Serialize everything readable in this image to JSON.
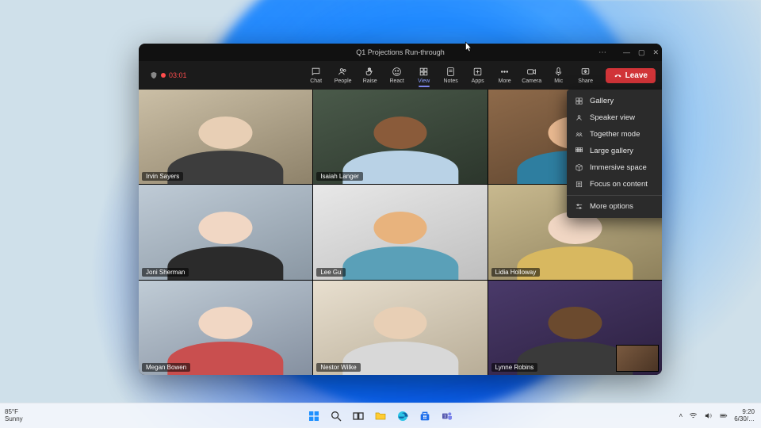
{
  "window": {
    "title": "Q1 Projections Run-through",
    "recording_timer": "03:01"
  },
  "toolbar": {
    "chat": "Chat",
    "people": "People",
    "raise": "Raise",
    "react": "React",
    "view": "View",
    "notes": "Notes",
    "apps": "Apps",
    "more": "More",
    "camera": "Camera",
    "mic": "Mic",
    "share": "Share",
    "leave": "Leave"
  },
  "view_menu": {
    "gallery": "Gallery",
    "speaker": "Speaker view",
    "together": "Together mode",
    "large_gallery": "Large gallery",
    "immersive": "Immersive space",
    "focus": "Focus on content",
    "more": "More options"
  },
  "participants": [
    "Irvin Sayers",
    "Isaiah Langer",
    "",
    "Joni Sherman",
    "Lee Gu",
    "Lidia Holloway",
    "Megan Bowen",
    "Nestor Wilke",
    "Lynne Robins"
  ],
  "taskbar": {
    "weather_temp": "85°F",
    "weather_cond": "Sunny",
    "time": "9:20",
    "date": "6/30/…"
  }
}
